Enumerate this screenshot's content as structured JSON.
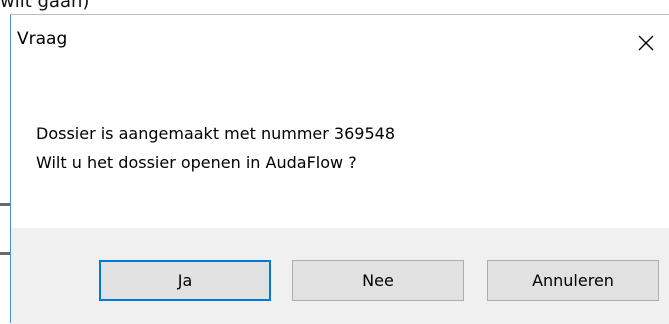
{
  "backdrop": {
    "partial_text": "wilt gaan)"
  },
  "dialog": {
    "title": "Vraag",
    "close_icon": "close-icon",
    "message_line_1": "Dossier is aangemaakt met nummer 369548",
    "message_line_2": "Wilt u het dossier openen in AudaFlow ?"
  },
  "buttons": {
    "yes_label": "Ja",
    "no_label": "Nee",
    "cancel_label": "Annuleren"
  },
  "colors": {
    "footer_background": "#f0f0f0",
    "button_background": "#e1e1e1",
    "default_button_border": "#0078d7",
    "window_accent": "#4a90d9"
  }
}
